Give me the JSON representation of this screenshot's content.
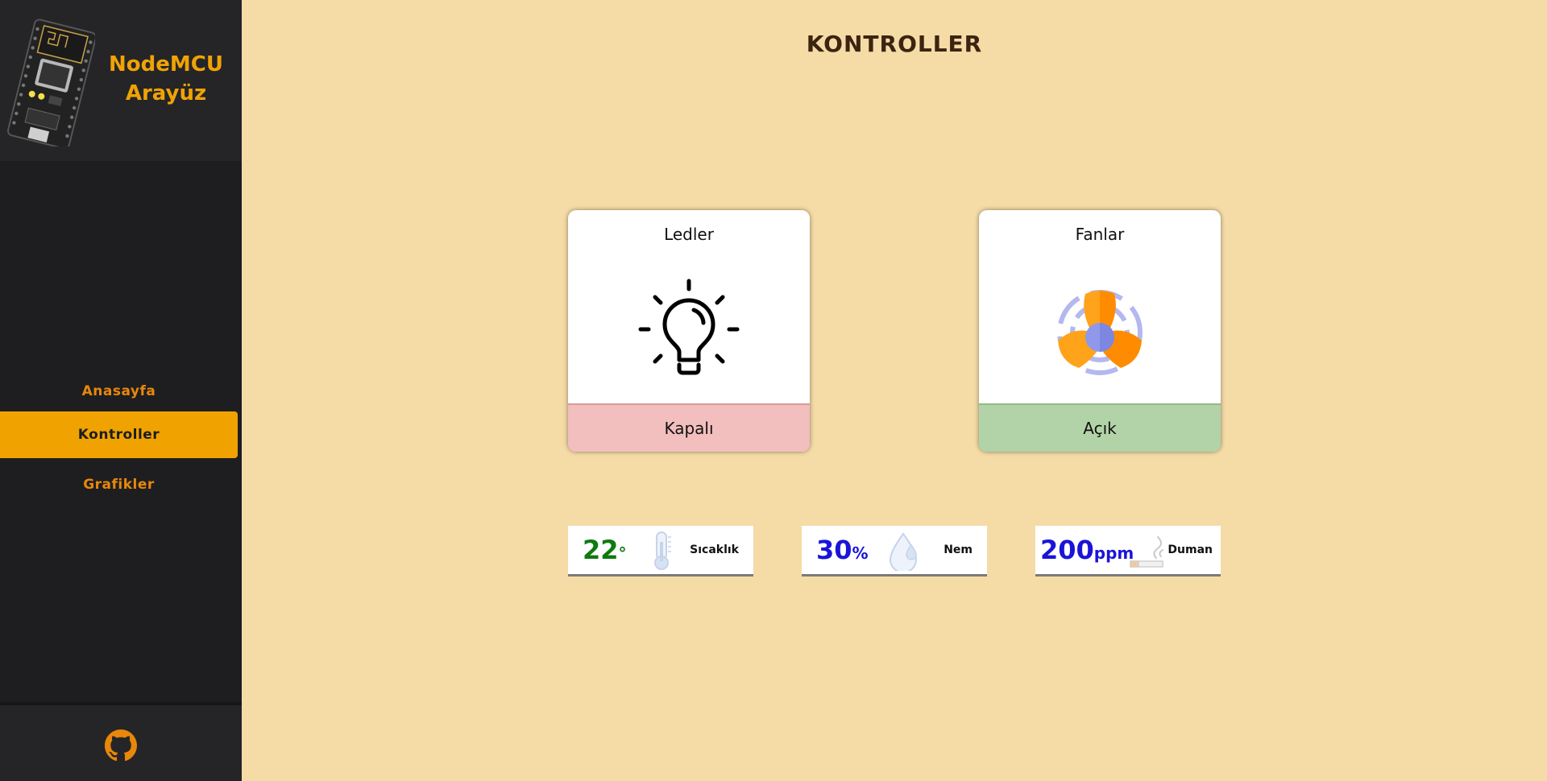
{
  "brand": {
    "line1": "NodeMCU",
    "line2": "Arayüz",
    "logo_icon": "nodemcu-board-icon"
  },
  "nav": {
    "items": [
      {
        "label": "Anasayfa",
        "active": false
      },
      {
        "label": "Kontroller",
        "active": true
      },
      {
        "label": "Grafikler",
        "active": false
      }
    ]
  },
  "footer": {
    "icon": "github-icon"
  },
  "page": {
    "title": "KONTROLLER"
  },
  "cards": [
    {
      "title": "Ledler",
      "icon": "lightbulb-icon",
      "status": "Kapalı",
      "status_color": "#f2bebe"
    },
    {
      "title": "Fanlar",
      "icon": "fan-icon",
      "status": "Açık",
      "status_color": "#b2d3a8"
    }
  ],
  "sensors": [
    {
      "value": "22",
      "unit": "°",
      "label": "Sıcaklık",
      "icon": "thermometer-icon",
      "color": "#0f7a0f"
    },
    {
      "value": "30",
      "unit": "%",
      "label": "Nem",
      "icon": "water-drop-icon",
      "color": "#1a14d9"
    },
    {
      "value": "200",
      "unit": "ppm",
      "label": "Duman",
      "icon": "cigarette-smoke-icon",
      "color": "#1a14d9"
    }
  ],
  "colors": {
    "accent": "#f0a300",
    "background": "#f5dba6",
    "sidebar": "#1e1e21"
  }
}
